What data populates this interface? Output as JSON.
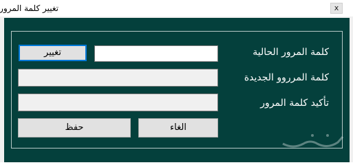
{
  "window": {
    "title": "تغيير كلمة المرور",
    "close_glyph": "x"
  },
  "form": {
    "current_password_label": "كلمة المرور الحالية",
    "new_password_label": "كلمة المرروو الجديدة",
    "confirm_password_label": "تأكيد كلمة المرور",
    "change_button_label": "تغيير",
    "cancel_button_label": "الغاء",
    "save_button_label": "حفظ",
    "current_password_value": "",
    "new_password_value": "",
    "confirm_password_value": ""
  },
  "colors": {
    "background": "#04403c",
    "label_text": "#ffffff"
  },
  "watermark": {
    "text": "حراج"
  }
}
